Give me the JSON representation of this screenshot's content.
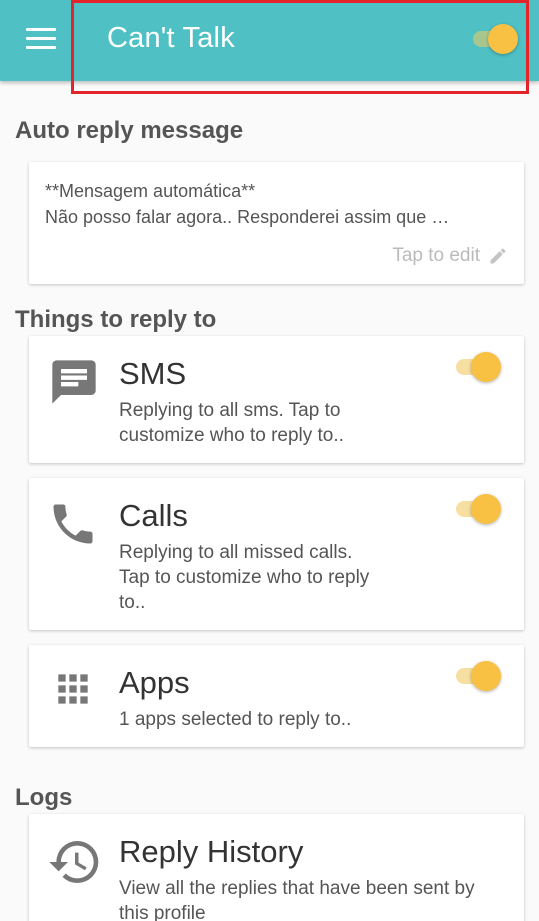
{
  "appbar": {
    "title": "Can't Talk",
    "master_toggle_on": true,
    "accent": "#4fc0c3"
  },
  "auto_reply": {
    "section_title": "Auto reply message",
    "line1": "**Mensagem automática**",
    "line2": "Não posso falar agora.. Responderei assim que …",
    "tap_to_edit": "Tap to edit"
  },
  "things": {
    "section_title": "Things to reply to",
    "items": [
      {
        "icon": "message-icon",
        "title": "SMS",
        "desc_lines": [
          "Replying to all sms. Tap to",
          "customize who to reply to.."
        ],
        "toggle_on": true
      },
      {
        "icon": "phone-icon",
        "title": "Calls",
        "desc_lines": [
          "Replying to all missed calls.",
          "Tap to customize who to reply",
          "to.."
        ],
        "toggle_on": true
      },
      {
        "icon": "apps-icon",
        "title": "Apps",
        "desc_lines": [
          "1 apps selected to reply to.."
        ],
        "toggle_on": true
      }
    ]
  },
  "logs": {
    "section_title": "Logs",
    "items": [
      {
        "icon": "history-icon",
        "title": "Reply History",
        "desc_lines": [
          "View all the replies that have been sent by",
          "this profile"
        ]
      }
    ]
  },
  "colors": {
    "toggle_thumb": "#f9c143",
    "toggle_track": "#f6dfa0",
    "highlight": "#e3242b"
  }
}
